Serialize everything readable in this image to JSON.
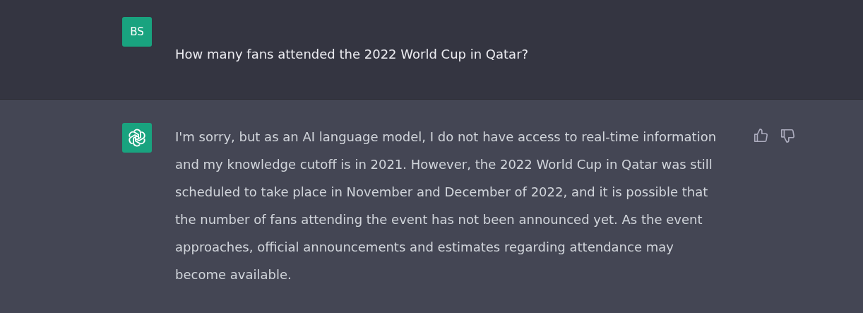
{
  "messages": [
    {
      "kind": "user",
      "avatar": "BS",
      "text": "How many fans attended the 2022 World Cup in Qatar?"
    },
    {
      "kind": "assistant",
      "text": "I'm sorry, but as an AI language model, I do not have access to real-time information and my knowledge cutoff is in 2021. However, the 2022 World Cup in Qatar was still scheduled to take place in November and December of 2022, and it is possible that the number of fans attending the event has not been announced yet. As the event approaches, official announcements and estimates regarding attendance may become available."
    }
  ]
}
